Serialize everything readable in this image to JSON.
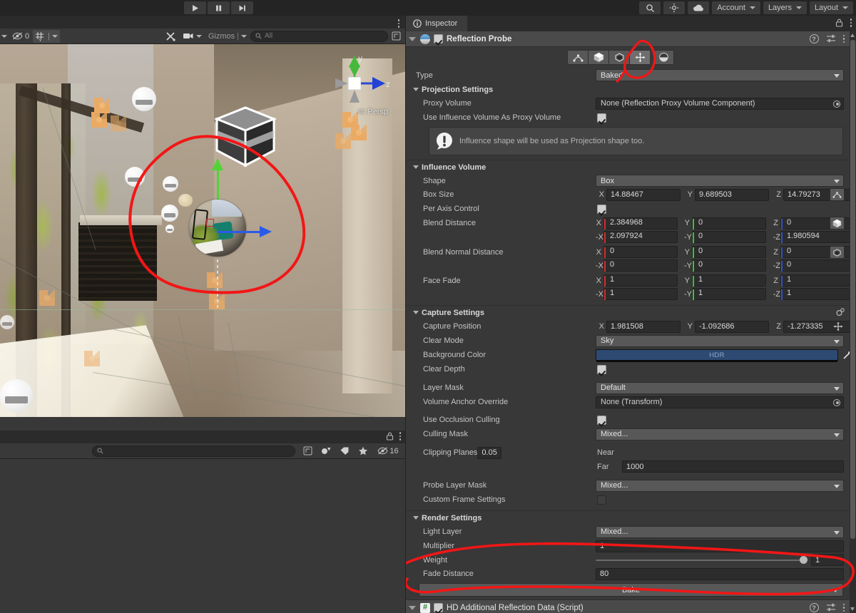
{
  "main_toolbar": {
    "playback": [
      {
        "name": "play-button",
        "icon": "play"
      },
      {
        "name": "pause-button",
        "icon": "pause"
      },
      {
        "name": "step-button",
        "icon": "step"
      }
    ],
    "right": [
      {
        "name": "search-button",
        "label": "",
        "icon": "search-icon"
      },
      {
        "name": "collab-button",
        "label": "",
        "icon": "lighting-icon"
      },
      {
        "name": "cloud-button",
        "label": "",
        "icon": "cloud-icon"
      },
      {
        "name": "account-dropdown",
        "label": "Account"
      },
      {
        "name": "layers-dropdown",
        "label": "Layers"
      },
      {
        "name": "layout-dropdown",
        "label": "Layout"
      }
    ]
  },
  "scene_view": {
    "toolbar": {
      "hidden_count": "0",
      "gizmos_label": "Gizmos",
      "search_placeholder": "All",
      "search_value": ""
    },
    "orientation": {
      "axis_y": "y",
      "axis_z": "z",
      "mode_label": "Persp"
    }
  },
  "lower_panel": {
    "search_placeholder": "",
    "visible_count": "16"
  },
  "inspector": {
    "tab_label": "Inspector",
    "component": {
      "title": "Reflection Probe",
      "enabled": true,
      "mode_buttons": [
        {
          "name": "influence-volume-mode-button",
          "icon": "influence-shape-icon",
          "active": false
        },
        {
          "name": "proxy-volume-mode-button",
          "icon": "box-icon",
          "active": false
        },
        {
          "name": "blend-distance-mode-button",
          "icon": "blend-icon",
          "active": false
        },
        {
          "name": "capture-position-mode-button",
          "icon": "move-icon",
          "active": true
        },
        {
          "name": "mirror-mode-button",
          "icon": "sphere-icon",
          "active": false
        }
      ],
      "type": {
        "label": "Type",
        "value": "Baked"
      },
      "projection_settings": {
        "title": "Projection Settings",
        "proxy_volume": {
          "label": "Proxy Volume",
          "value": "None (Reflection Proxy Volume Component)"
        },
        "use_influence_as_proxy": {
          "label": "Use Influence Volume As Proxy Volume",
          "checked": true
        },
        "info": "Influence shape will be used as Projection shape too."
      },
      "influence_volume": {
        "title": "Influence Volume",
        "shape": {
          "label": "Shape",
          "value": "Box"
        },
        "box_size": {
          "label": "Box Size",
          "x": "14.88467",
          "y": "9.689503",
          "z": "14.79273"
        },
        "per_axis_control": {
          "label": "Per Axis Control",
          "checked": true
        },
        "blend_distance": {
          "label": "Blend Distance",
          "pos": {
            "x": "2.384968",
            "y": "0",
            "z": "0"
          },
          "neg": {
            "x": "2.097924",
            "y": "0",
            "z": "1.980594"
          }
        },
        "blend_normal_distance": {
          "label": "Blend Normal Distance",
          "pos": {
            "x": "0",
            "y": "0",
            "z": "0"
          },
          "neg": {
            "x": "0",
            "y": "0",
            "z": "0"
          }
        },
        "face_fade": {
          "label": "Face Fade",
          "pos": {
            "x": "1",
            "y": "1",
            "z": "1"
          },
          "neg": {
            "x": "1",
            "y": "1",
            "z": "1"
          }
        }
      },
      "capture_settings": {
        "title": "Capture Settings",
        "capture_position": {
          "label": "Capture Position",
          "x": "1.981508",
          "y": "-1.092686",
          "z": "-1.273335"
        },
        "clear_mode": {
          "label": "Clear Mode",
          "value": "Sky"
        },
        "background_color": {
          "label": "Background Color",
          "badge": "HDR",
          "color": "#2d4a73"
        },
        "clear_depth": {
          "label": "Clear Depth",
          "checked": true
        },
        "layer_mask": {
          "label": "Layer Mask",
          "value": "Default"
        },
        "volume_anchor_override": {
          "label": "Volume Anchor Override",
          "value": "None (Transform)"
        },
        "use_occlusion_culling": {
          "label": "Use Occlusion Culling",
          "checked": true
        },
        "culling_mask": {
          "label": "Culling Mask",
          "value": "Mixed..."
        },
        "clipping_planes": {
          "label": "Clipping Planes",
          "near_label": "Near",
          "near": "0.05",
          "far_label": "Far",
          "far": "1000"
        },
        "probe_layer_mask": {
          "label": "Probe Layer Mask",
          "value": "Mixed..."
        },
        "custom_frame_settings": {
          "label": "Custom Frame Settings",
          "checked": false
        }
      },
      "render_settings": {
        "title": "Render Settings",
        "light_layer": {
          "label": "Light Layer",
          "value": "Mixed..."
        },
        "multiplier": {
          "label": "Multiplier",
          "value": "1"
        },
        "weight": {
          "label": "Weight",
          "value": "1",
          "slider_pct": 100
        },
        "fade_distance": {
          "label": "Fade Distance",
          "value": "80"
        }
      },
      "bake_button": "Bake"
    },
    "component2": {
      "title": "HD Additional Reflection Data (Script)",
      "enabled": true
    },
    "axis_colors": {
      "x": "#d03030",
      "y": "#3ec23e",
      "z": "#3050d0"
    }
  }
}
